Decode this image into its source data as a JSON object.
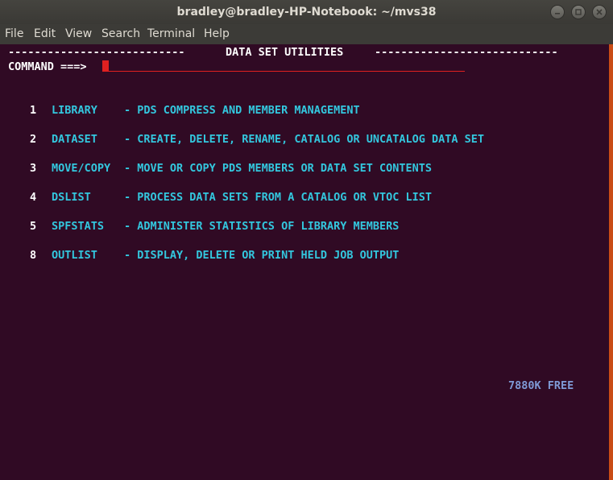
{
  "window": {
    "title": "bradley@bradley-HP-Notebook: ~/mvs38",
    "buttons": [
      "minimize-icon",
      "maximize-icon",
      "close-icon"
    ]
  },
  "menubar": {
    "items": [
      "File",
      "Edit",
      "View",
      "Search",
      "Terminal",
      "Help"
    ]
  },
  "screen": {
    "header_left": "---------------------------",
    "header_title": "DATA SET UTILITIES",
    "header_right": "----------------------------",
    "command_label": "COMMAND ===>",
    "command_value": "",
    "options": [
      {
        "num": "1",
        "name": "LIBRARY",
        "desc": "- PDS COMPRESS AND MEMBER MANAGEMENT"
      },
      {
        "num": "2",
        "name": "DATASET",
        "desc": "- CREATE, DELETE, RENAME, CATALOG OR UNCATALOG DATA SET"
      },
      {
        "num": "3",
        "name": "MOVE/COPY",
        "desc": "- MOVE OR COPY PDS MEMBERS OR DATA SET CONTENTS"
      },
      {
        "num": "4",
        "name": "DSLIST",
        "desc": "- PROCESS DATA SETS FROM A CATALOG OR VTOC LIST"
      },
      {
        "num": "5",
        "name": "SPFSTATS",
        "desc": "- ADMINISTER STATISTICS OF LIBRARY MEMBERS"
      },
      {
        "num": "8",
        "name": "OUTLIST",
        "desc": "- DISPLAY, DELETE OR PRINT HELD JOB OUTPUT"
      }
    ],
    "free_memory": "7880K FREE"
  },
  "colors": {
    "terminal_bg": "#300a24",
    "text_white": "#ffffff",
    "text_cyan": "#33c7de",
    "text_blue": "#7f9ad6",
    "cursor_red": "#e02020"
  }
}
